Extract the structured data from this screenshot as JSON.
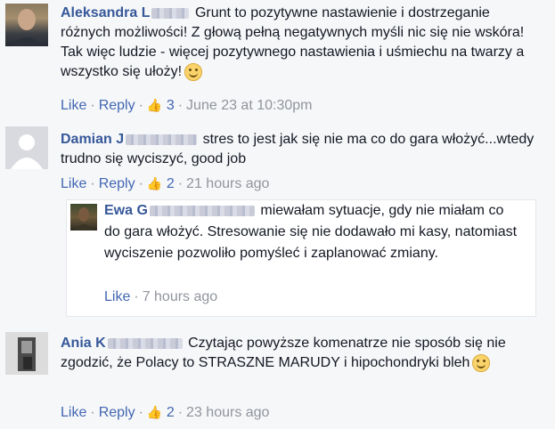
{
  "comments": [
    {
      "author": "Aleksandra L",
      "text": "Grunt to pozytywne nastawienie i dostrzeganie różnych możliwości! Z głową pełną negatywnych myśli nic się nie wskóra! Tak więc ludzie - więcej pozytywnego nastawienia i uśmiechu na twarzy a wszystko się ułoży!",
      "like": "Like",
      "reply": "Reply",
      "likes_count": "3",
      "time": "June 23 at 10:30pm"
    },
    {
      "author": "Damian J",
      "text": "stres to jest jak się nie ma co do gara włożyć...wtedy trudno się wyciszyć, good job",
      "like": "Like",
      "reply": "Reply",
      "likes_count": "2",
      "time": "21 hours ago",
      "reply_item": {
        "author": "Ewa G",
        "text": "miewałam sytuacje, gdy nie miałam co do gara włożyć. Stresowanie się nie dodawało mi kasy, natomiast wyciszenie pozwoliło pomyśleć i zaplanować zmiany.",
        "like": "Like",
        "time": "7 hours ago"
      }
    },
    {
      "author": "Ania K",
      "text": "Czytając powyższe komenatrze nie sposób się nie zgodzić, że Polacy to STRASZNE MARUDY i hipochondryki bleh",
      "like": "Like",
      "reply": "Reply",
      "likes_count": "2",
      "time": "23 hours ago"
    }
  ],
  "colors": {
    "link": "#365899",
    "meta": "#90949c",
    "action": "#4267b2"
  }
}
